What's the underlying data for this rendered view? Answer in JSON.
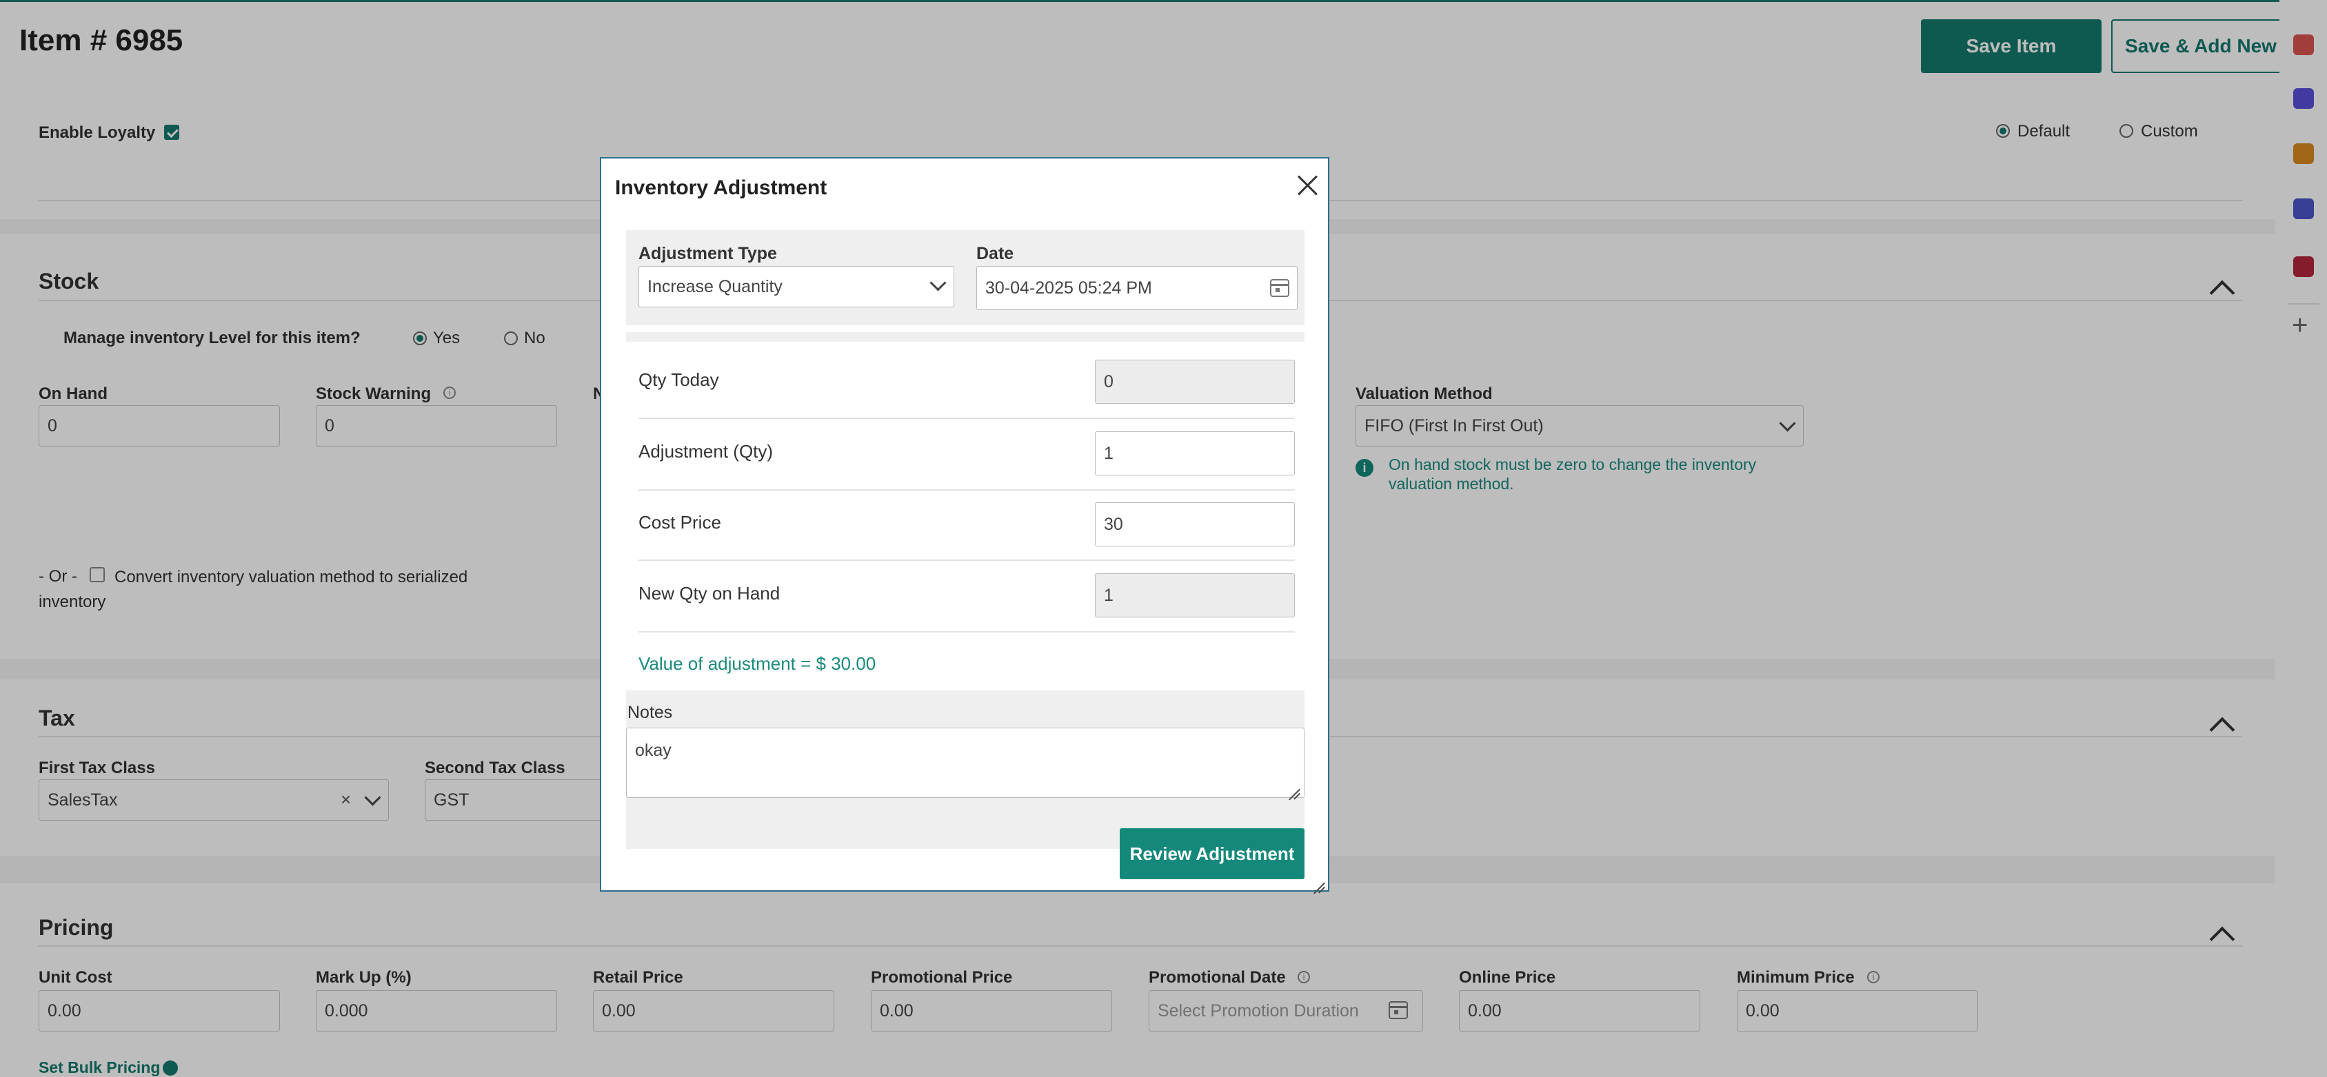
{
  "header": {
    "title": "Item # 6985",
    "save_label": "Save Item",
    "save_add_label": "Save & Add New"
  },
  "loyalty": {
    "label": "Enable Loyalty",
    "checked": true,
    "option_default": "Default",
    "option_custom": "Custom",
    "selected": "Default"
  },
  "stock": {
    "title": "Stock",
    "manage_label": "Manage inventory Level for this item?",
    "yes": "Yes",
    "no": "No",
    "selected": "Yes",
    "on_hand_label": "On Hand",
    "on_hand_value": "0",
    "stock_warning_label": "Stock Warning",
    "stock_warning_value": "0",
    "hidden_label_fragment": "N",
    "valuation_label": "Valuation Method",
    "valuation_value": "FIFO (First In First Out)",
    "valuation_note": "On hand stock must be zero to change the inventory valuation method.",
    "or_text": "- Or -",
    "convert_text": "Convert inventory valuation method to serialized inventory"
  },
  "tax": {
    "title": "Tax",
    "first_label": "First Tax Class",
    "first_value": "SalesTax",
    "second_label": "Second Tax Class",
    "second_value": "GST"
  },
  "pricing": {
    "title": "Pricing",
    "unit_cost_label": "Unit Cost",
    "unit_cost_value": "0.00",
    "markup_label": "Mark Up (%)",
    "markup_value": "0.000",
    "retail_label": "Retail Price",
    "retail_value": "0.00",
    "promo_label": "Promotional Price",
    "promo_value": "0.00",
    "promo_date_label": "Promotional Date",
    "promo_date_placeholder": "Select Promotion Duration",
    "online_label": "Online Price",
    "online_value": "0.00",
    "minimum_label": "Minimum Price",
    "minimum_value": "0.00",
    "bulk_link": "Set Bulk Pricing"
  },
  "modal": {
    "title": "Inventory Adjustment",
    "adjustment_type_label": "Adjustment Type",
    "adjustment_type_value": "Increase Quantity",
    "date_label": "Date",
    "date_value": "30-04-2025 05:24 PM",
    "qty_today_label": "Qty Today",
    "qty_today_value": "0",
    "adjustment_qty_label": "Adjustment (Qty)",
    "adjustment_qty_value": "1",
    "cost_price_label": "Cost Price",
    "cost_price_value": "30",
    "new_qty_label": "New Qty on Hand",
    "new_qty_value": "1",
    "value_text": "Value of adjustment = $ 30.00",
    "notes_label": "Notes",
    "notes_value": "okay",
    "review_label": "Review Adjustment"
  },
  "toolbar": {
    "icons": [
      "shop-icon",
      "chat-icon",
      "note-icon",
      "puzzle-icon",
      "wallet-icon",
      "plus-icon"
    ]
  },
  "colors": {
    "brand": "#14786c",
    "accent_text": "#1a8a7d",
    "modal_border": "#2a6f8f"
  }
}
